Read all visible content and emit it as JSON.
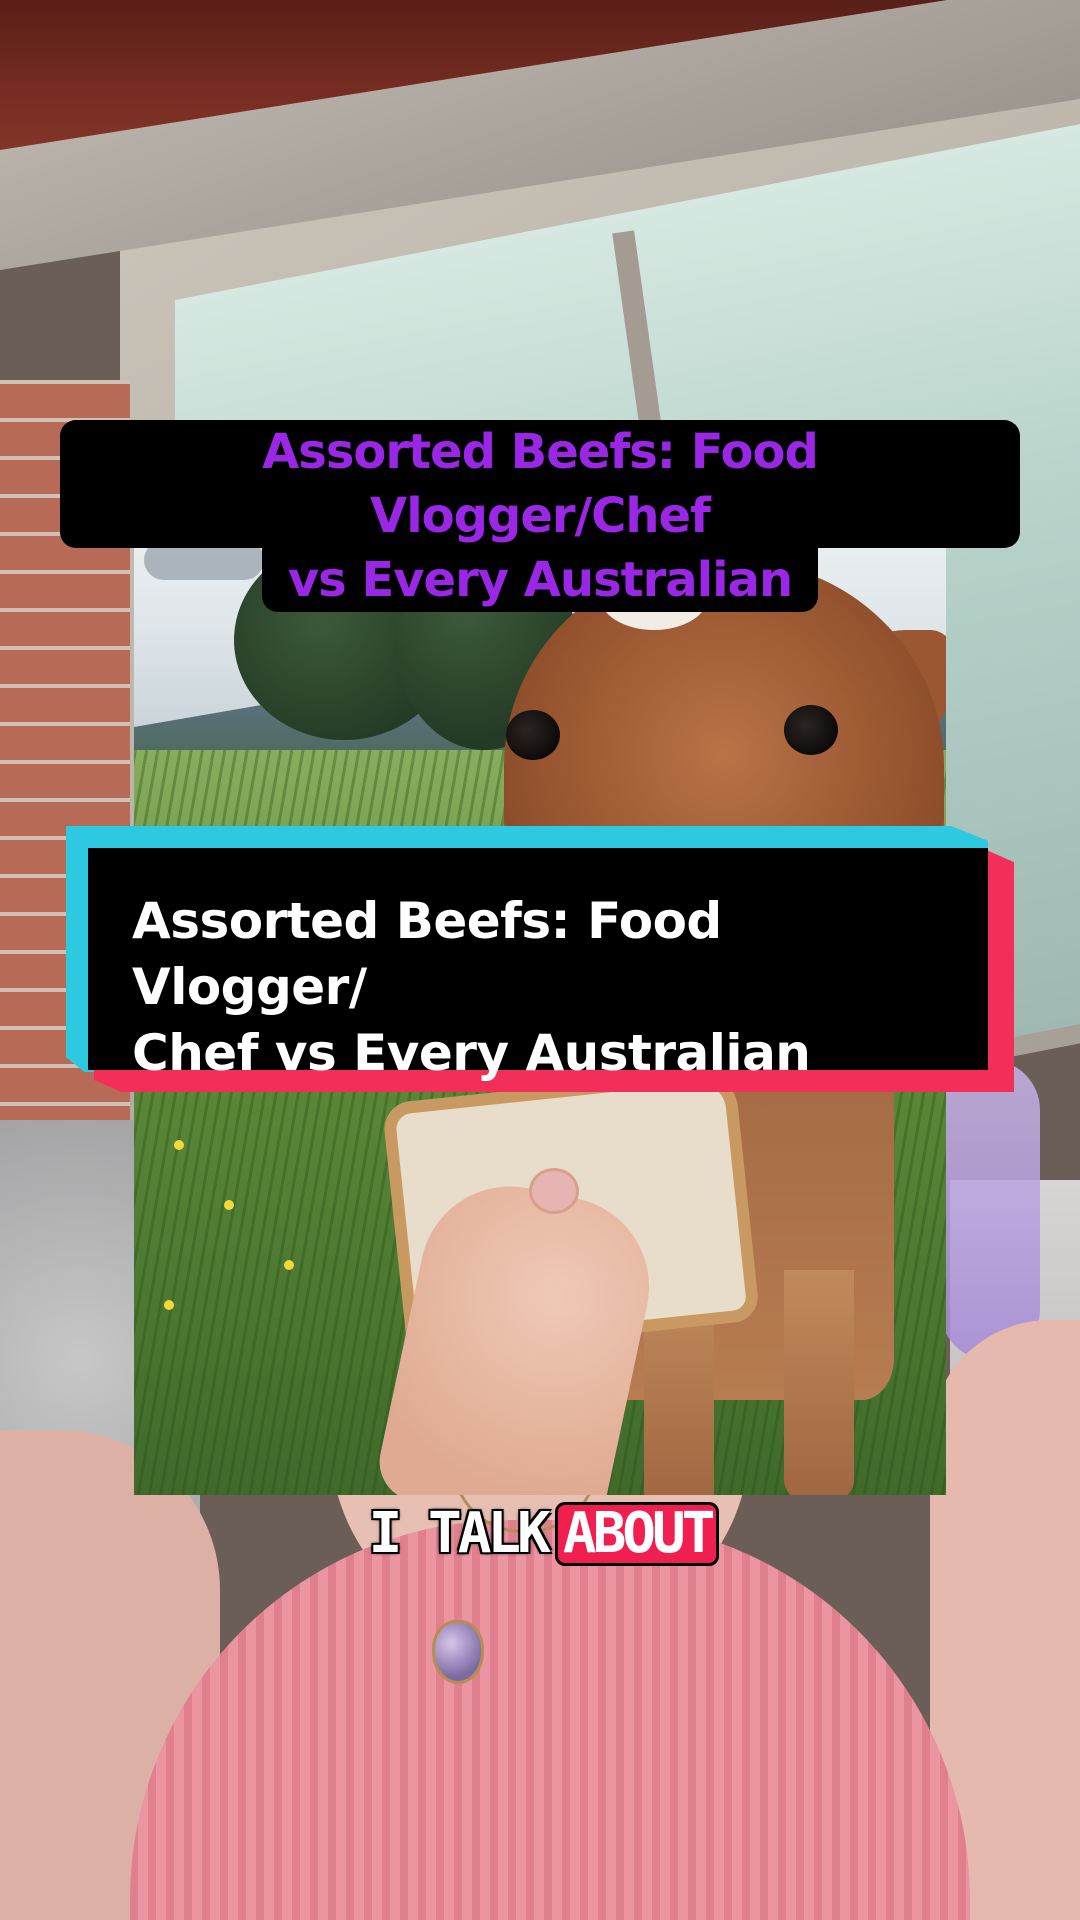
{
  "overlay_title": {
    "line1": "Assorted Beefs: Food Vlogger/Chef",
    "line2": "vs Every Australian",
    "color": "#9a26e6"
  },
  "card": {
    "line1": "Assorted Beefs: Food Vlogger/",
    "line2": "Chef vs Every Australian",
    "accent_colors": [
      "#2cc9e0",
      "#f22e59"
    ]
  },
  "caption": {
    "word1": "I TALK",
    "word2": "ABOUT",
    "highlight_color": "#f01f4f"
  }
}
